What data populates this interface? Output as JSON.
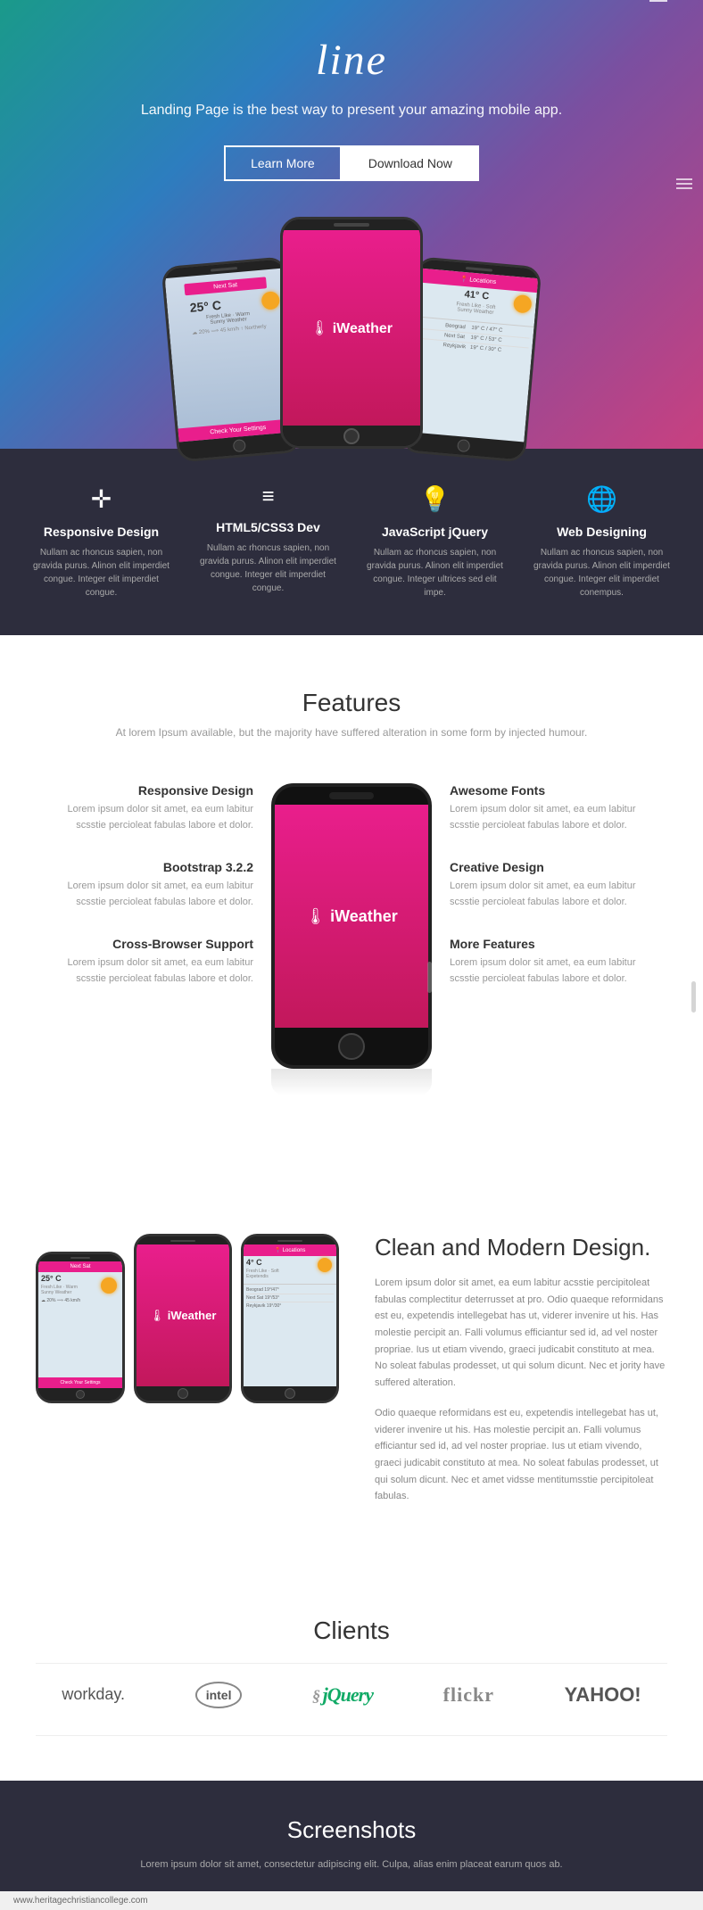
{
  "hero": {
    "title": "line",
    "subtitle": "Landing Page is the best way to present your amazing mobile app.",
    "btn_learn": "Learn More",
    "btn_download": "Download Now"
  },
  "features_dark": {
    "items": [
      {
        "icon": "✛",
        "title": "Responsive Design",
        "desc": "Nullam ac rhoncus sapien, non gravida purus. Alinon elit imperdiet congue. Integer elit imperdiet congue."
      },
      {
        "icon": "≡",
        "title": "HTML5/CSS3 Dev",
        "desc": "Nullam ac rhoncus sapien, non gravida purus. Alinon elit imperdiet congue. Integer elit imperdiet congue."
      },
      {
        "icon": "💡",
        "title": "JavaScript jQuery",
        "desc": "Nullam ac rhoncus sapien, non gravida purus. Alinon elit imperdiet congue. Integer ultrices sed elit impe."
      },
      {
        "icon": "🌐",
        "title": "Web Designing",
        "desc": "Nullam ac rhoncus sapien, non gravida purus. Alinon elit imperdiet congue. Integer elit imperdiet conempus."
      }
    ]
  },
  "features_light": {
    "title": "Features",
    "subtitle": "At lorem Ipsum available, but the majority have suffered alteration in some form by injected humour.",
    "left_features": [
      {
        "title": "Responsive Design",
        "desc": "Lorem ipsum dolor sit amet, ea eum labitur scsstie percioleat fabulas labore et dolor."
      },
      {
        "title": "Bootstrap 3.2.2",
        "desc": "Lorem ipsum dolor sit amet, ea eum labitur scsstie percioleat fabulas labore et dolor."
      },
      {
        "title": "Cross-Browser Support",
        "desc": "Lorem ipsum dolor sit amet, ea eum labitur scsstie percioleat fabulas labore et dolor."
      }
    ],
    "right_features": [
      {
        "title": "Awesome Fonts",
        "desc": "Lorem ipsum dolor sit amet, ea eum labitur scsstie percioleat fabulas labore et dolor."
      },
      {
        "title": "Creative Design",
        "desc": "Lorem ipsum dolor sit amet, ea eum labitur scsstie percioleat fabulas labore et dolor."
      },
      {
        "title": "More Features",
        "desc": "Lorem ipsum dolor sit amet, ea eum labitur scsstie percioleat fabulas labore et dolor."
      }
    ]
  },
  "modern_section": {
    "title": "Clean and Modern Design.",
    "desc1": "Lorem ipsum dolor sit amet, ea eum labitur acsstie percipitoleat fabulas complectitur deterrusset at pro. Odio quaeque reformidans est eu, expetendis intellegebat has ut, viderer invenire ut his. Has molestie percipit an. Falli volumus efficiantur sed id, ad vel noster propriae. Ius ut etiam vivendo, graeci judicabit constituto at mea. No soleat fabulas prodesset, ut qui solum dicunt. Nec et jority have suffered alteration.",
    "desc2": "Odio quaeque reformidans est eu, expetendis intellegebat has ut, viderer invenire ut his. Has molestie percipit an. Falli volumus efficiantur sed id, ad vel noster propriae. Ius ut etiam vivendo, graeci judicabit constituto at mea. No soleat fabulas prodesset, ut qui solum dicunt. Nec et amet vidsse mentitumsstie percipitoleat fabulas."
  },
  "clients": {
    "title": "Clients",
    "logos": [
      "workday.",
      "intel",
      "jQuery",
      "flickr",
      "YAHOO!"
    ]
  },
  "screenshots": {
    "title": "Screenshots",
    "subtitle": "Lorem ipsum dolor sit amet, consectetur adipiscing elit. Culpa, alias enim placeat earum quos ab."
  },
  "footer": {
    "url": "www.heritagechristiancollege.com"
  }
}
